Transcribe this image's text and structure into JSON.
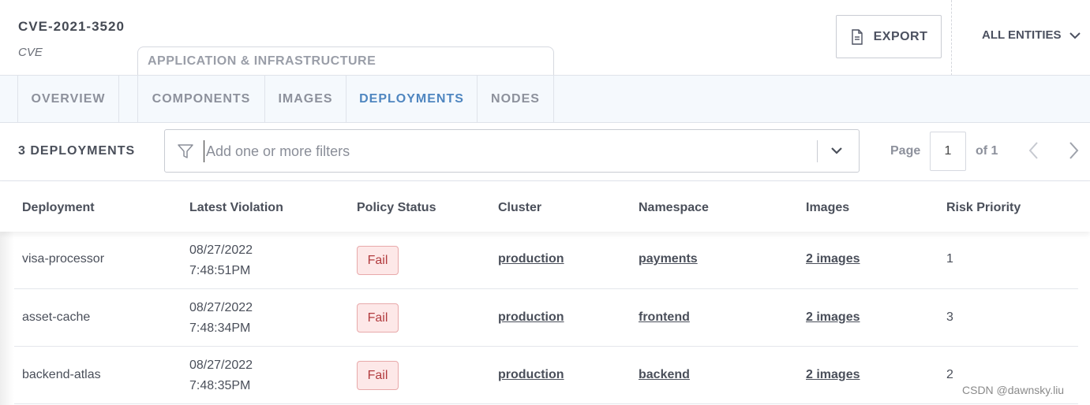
{
  "header": {
    "entity_name": "CVE-2021-3520",
    "entity_type": "CVE",
    "export_label": "EXPORT",
    "all_entities_label": "ALL ENTITIES"
  },
  "group": {
    "label": "APPLICATION & INFRASTRUCTURE"
  },
  "tabs": [
    {
      "label": "OVERVIEW",
      "active": false
    },
    {
      "label": "COMPONENTS",
      "active": false
    },
    {
      "label": "IMAGES",
      "active": false
    },
    {
      "label": "DEPLOYMENTS",
      "active": true
    },
    {
      "label": "NODES",
      "active": false
    }
  ],
  "toolbar": {
    "count_label": "3 DEPLOYMENTS",
    "search_placeholder": "Add one or more filters",
    "page_label": "Page",
    "page_value": "1",
    "of_label": "of 1"
  },
  "table": {
    "columns": [
      "Deployment",
      "Latest Violation",
      "Policy Status",
      "Cluster",
      "Namespace",
      "Images",
      "Risk Priority"
    ],
    "rows": [
      {
        "deployment": "visa-processor",
        "violation_date": "08/27/2022",
        "violation_time": "7:48:51PM",
        "policy_status": "Fail",
        "cluster": "production",
        "namespace": "payments",
        "images": "2 images",
        "risk_priority": "1"
      },
      {
        "deployment": "asset-cache",
        "violation_date": "08/27/2022",
        "violation_time": "7:48:34PM",
        "policy_status": "Fail",
        "cluster": "production",
        "namespace": "frontend",
        "images": "2 images",
        "risk_priority": "3"
      },
      {
        "deployment": "backend-atlas",
        "violation_date": "08/27/2022",
        "violation_time": "7:48:35PM",
        "policy_status": "Fail",
        "cluster": "production",
        "namespace": "backend",
        "images": "2 images",
        "risk_priority": "2"
      }
    ]
  },
  "watermark": "CSDN @dawnsky.liu",
  "colors": {
    "active_tab": "#4f86c0",
    "fail_badge_bg": "#fde8e8",
    "fail_badge_text": "#b23c3f",
    "tabs_bg": "#f5f9fd"
  }
}
